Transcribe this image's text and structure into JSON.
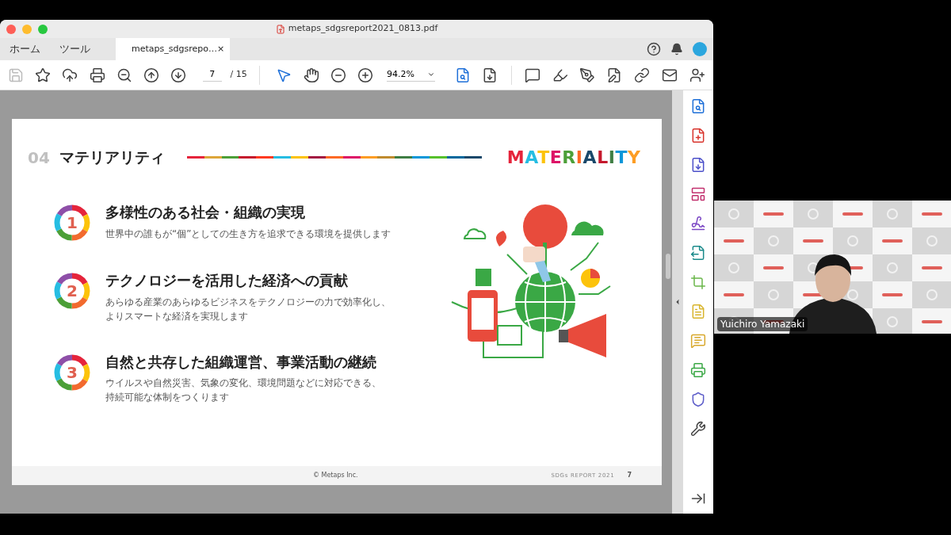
{
  "window": {
    "title": "metaps_sdgsreport2021_0813.pdf"
  },
  "nav_tabs": [
    {
      "label": "ホーム",
      "selected": false
    },
    {
      "label": "ツール",
      "selected": false
    }
  ],
  "document_tab": {
    "label": "metaps_sdgsrepo…",
    "selected": true,
    "close": "×"
  },
  "toolbar": {
    "page_field": "7",
    "page_total": "/ 15",
    "zoom": "94.2%"
  },
  "slide": {
    "section_number": "04",
    "section_title": "マテリアリティ",
    "logo": "MATERIALITY",
    "items": [
      {
        "number": "1",
        "title": "多様性のある社会・組織の実現",
        "lines": [
          "世界中の誰もが“個”としての生き方を追求できる環境を提供します"
        ]
      },
      {
        "number": "2",
        "title": "テクノロジーを活用した経済への貢献",
        "lines": [
          "あらゆる産業のあらゆるビジネスをテクノロジーの力で効率化し、",
          "よりスマートな経済を実現します"
        ]
      },
      {
        "number": "3",
        "title": "自然と共存した組織運営、事業活動の継続",
        "lines": [
          "ウイルスや自然災害、気象の変化、環境問題などに対応できる、",
          "持続可能な体制をつくります"
        ]
      }
    ],
    "footer": {
      "copyright": "© Metaps Inc.",
      "report": "SDGs REPORT 2021",
      "page": "7"
    }
  },
  "video": {
    "name": "Yuichiro Yamazaki"
  }
}
